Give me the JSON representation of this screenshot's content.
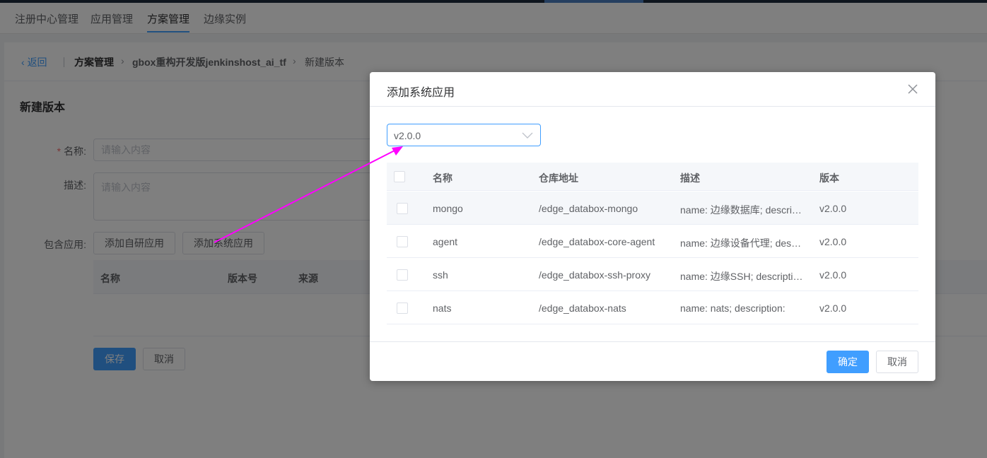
{
  "nav": {
    "tabs": [
      {
        "label": "注册中心管理"
      },
      {
        "label": "应用管理"
      },
      {
        "label": "方案管理"
      },
      {
        "label": "边缘实例"
      }
    ],
    "active_index": 2
  },
  "breadcrumb": {
    "back": "返回",
    "items": [
      "方案管理",
      "gbox重构开发版jenkinshost_ai_tf",
      "新建版本"
    ]
  },
  "form": {
    "title": "新建版本",
    "name_label": "名称:",
    "name_placeholder": "请输入内容",
    "desc_label": "描述:",
    "desc_placeholder": "请输入内容",
    "apps_label": "包含应用:",
    "add_custom_button": "添加自研应用",
    "add_system_button": "添加系统应用",
    "table_headers": [
      "名称",
      "版本号",
      "来源"
    ],
    "save_button": "保存",
    "cancel_button": "取消"
  },
  "dialog": {
    "title": "添加系统应用",
    "select_value": "v2.0.0",
    "headers": [
      "名称",
      "仓库地址",
      "描述",
      "版本"
    ],
    "rows": [
      {
        "name": "mongo",
        "repo": "/edge_databox-mongo",
        "desc": "name: 边缘数据库; descri…",
        "version": "v2.0.0"
      },
      {
        "name": "agent",
        "repo": "/edge_databox-core-agent",
        "desc": "name: 边缘设备代理; des…",
        "version": "v2.0.0"
      },
      {
        "name": "ssh",
        "repo": "/edge_databox-ssh-proxy",
        "desc": "name: 边缘SSH; descripti…",
        "version": "v2.0.0"
      },
      {
        "name": "nats",
        "repo": "/edge_databox-nats",
        "desc": "name: nats; description:",
        "version": "v2.0.0"
      }
    ],
    "confirm_button": "确定",
    "cancel_button": "取消"
  },
  "colors": {
    "primary": "#409eff",
    "annotation_arrow": "#ff00ff"
  }
}
